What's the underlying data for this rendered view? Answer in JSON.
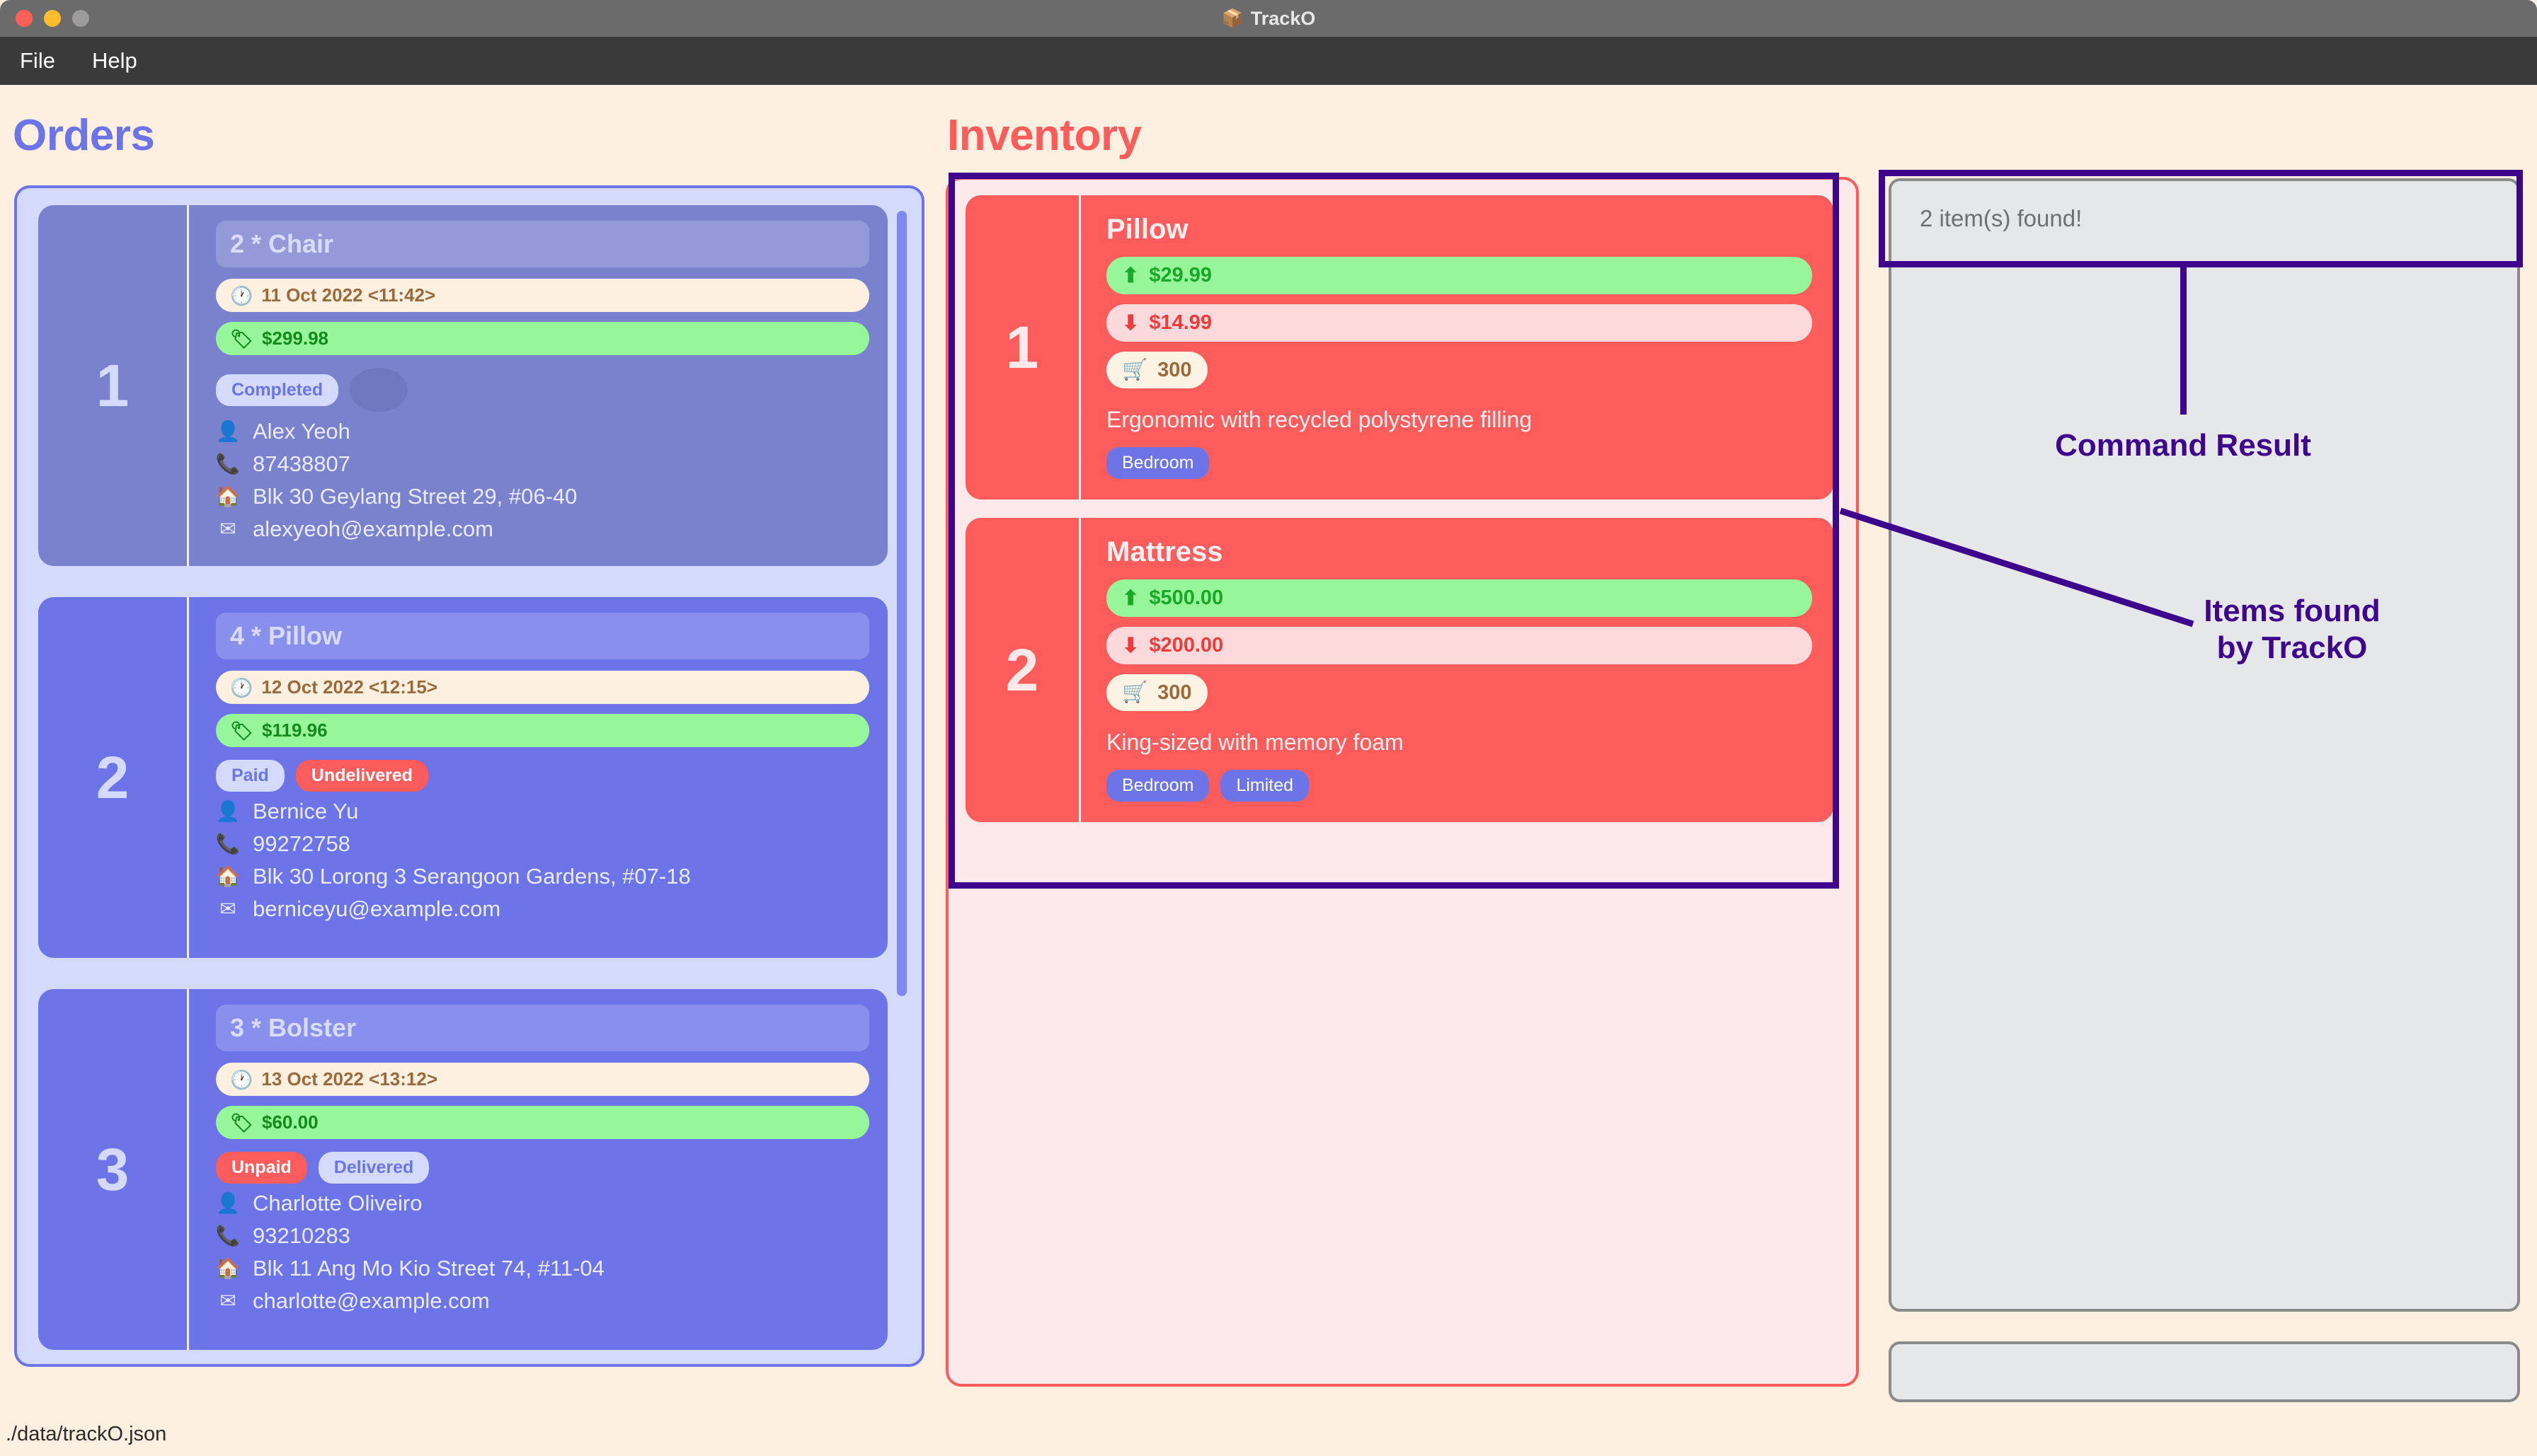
{
  "window": {
    "title": "TrackO",
    "title_icon": "package-icon",
    "title_icon_glyph": "📦",
    "traffic_lights": [
      "close",
      "minimize",
      "maximize"
    ]
  },
  "menubar": {
    "items": [
      {
        "label": "File"
      },
      {
        "label": "Help"
      }
    ]
  },
  "colors": {
    "app_background": "#fdf0e0",
    "orders_accent": "#6c74e8",
    "inventory_accent": "#fc5c5c",
    "annotation": "#3d068c",
    "price_green": "#97f59a",
    "date_brown": "#9b6a3c"
  },
  "orders": {
    "heading": "Orders",
    "cards": [
      {
        "index": "1",
        "title": "2 * Chair",
        "date": "11 Oct 2022 <11:42>",
        "date_icon": "clock-icon",
        "price": "$299.98",
        "price_icon": "price-tag-icon",
        "badges": [
          {
            "label": "Completed",
            "style": "neutral"
          },
          {
            "label": "",
            "style": "ghost"
          }
        ],
        "customer": "Alex Yeoh",
        "phone": "87438807",
        "address": "Blk 30 Geylang Street 29, #06-40",
        "email": "alexyeoh@example.com"
      },
      {
        "index": "2",
        "title": "4 * Pillow",
        "date": "12 Oct 2022 <12:15>",
        "date_icon": "clock-icon",
        "price": "$119.96",
        "price_icon": "price-tag-icon",
        "badges": [
          {
            "label": "Paid",
            "style": "neutral"
          },
          {
            "label": "Undelivered",
            "style": "danger"
          }
        ],
        "customer": "Bernice Yu",
        "phone": "99272758",
        "address": "Blk 30 Lorong 3 Serangoon Gardens, #07-18",
        "email": "berniceyu@example.com"
      },
      {
        "index": "3",
        "title": "3 * Bolster",
        "date": "13 Oct 2022 <13:12>",
        "date_icon": "clock-icon",
        "price": "$60.00",
        "price_icon": "price-tag-icon",
        "badges": [
          {
            "label": "Unpaid",
            "style": "danger"
          },
          {
            "label": "Delivered",
            "style": "neutral"
          }
        ],
        "customer": "Charlotte Oliveiro",
        "phone": "93210283",
        "address": "Blk 11 Ang Mo Kio Street 74, #11-04",
        "email": "charlotte@example.com"
      }
    ]
  },
  "inventory": {
    "heading": "Inventory",
    "cards": [
      {
        "index": "1",
        "name": "Pillow",
        "sell_price": "$29.99",
        "sell_icon": "arrow-up-dollar-icon",
        "cost_price": "$14.99",
        "cost_icon": "arrow-down-dollar-icon",
        "quantity": "300",
        "quantity_icon": "shopping-cart-icon",
        "description": "Ergonomic with recycled polystyrene filling",
        "tags": [
          "Bedroom"
        ]
      },
      {
        "index": "2",
        "name": "Mattress",
        "sell_price": "$500.00",
        "sell_icon": "arrow-up-dollar-icon",
        "cost_price": "$200.00",
        "cost_icon": "arrow-down-dollar-icon",
        "quantity": "300",
        "quantity_icon": "shopping-cart-icon",
        "description": "King-sized with memory foam",
        "tags": [
          "Bedroom",
          "Limited"
        ]
      }
    ]
  },
  "result_panel": {
    "text": "2 item(s) found!"
  },
  "command_input": {
    "value": "",
    "placeholder": ""
  },
  "statusbar": {
    "path": "./data/trackO.json"
  },
  "annotations": {
    "command_result": "Command Result",
    "items_found": "Items found\nby TrackO",
    "items_found_line1": "Items found",
    "items_found_line2": "by TrackO"
  }
}
